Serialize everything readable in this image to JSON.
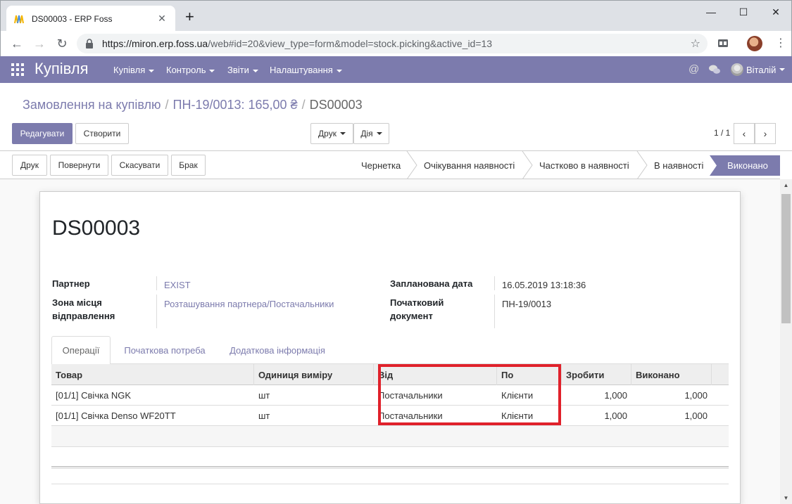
{
  "browser": {
    "tab_title": "DS00003 - ERP Foss",
    "url_host": "https://miron.erp.foss.ua",
    "url_path": "/web#id=20&view_type=form&model=stock.picking&active_id=13",
    "new_tab": "+",
    "close": "✕"
  },
  "navbar": {
    "brand": "Купівля",
    "menus": [
      "Купівля",
      "Контроль",
      "Звіти",
      "Налаштування"
    ],
    "user": "Віталій"
  },
  "breadcrumb": {
    "items": [
      "Замовлення на купівлю",
      "ПН-19/0013: 165,00 ₴"
    ],
    "active": "DS00003",
    "separator": "/"
  },
  "buttons": {
    "edit": "Редагувати",
    "create": "Створити",
    "print": "Друк",
    "action": "Дія"
  },
  "pager": {
    "value": "1 / 1"
  },
  "statusbar": {
    "buttons": [
      "Друк",
      "Повернути",
      "Скасувати",
      "Брак"
    ],
    "stages": [
      "Чернетка",
      "Очікування наявності",
      "Частково в наявності",
      "В наявності"
    ],
    "current_stage": "Виконано"
  },
  "form": {
    "title": "DS00003",
    "partner_label": "Партнер",
    "partner_value": "EXIST",
    "source_location_label_1": "Зона місця",
    "source_location_label_2": "відправлення",
    "source_location_value": "Розташування партнера/Постачальники",
    "scheduled_date_label": "Запланована дата",
    "scheduled_date_value": "16.05.2019 13:18:36",
    "source_doc_label_1": "Початковий",
    "source_doc_label_2": "документ",
    "source_doc_value": "ПН-19/0013"
  },
  "tabs": [
    "Операції",
    "Початкова потреба",
    "Додаткова інформація"
  ],
  "table": {
    "headers": [
      "Товар",
      "Одиниця виміру",
      "Від",
      "По",
      "Зробити",
      "Виконано"
    ],
    "rows": [
      [
        "[01/1] Свічка NGK",
        "шт",
        "Постачальники",
        "Клієнти",
        "1,000",
        "1,000"
      ],
      [
        "[01/1] Свічка Denso WF20TT",
        "шт",
        "Постачальники",
        "Клієнти",
        "1,000",
        "1,000"
      ]
    ]
  },
  "colors": {
    "brand": "#7c7bad",
    "highlight": "#e0212b"
  }
}
